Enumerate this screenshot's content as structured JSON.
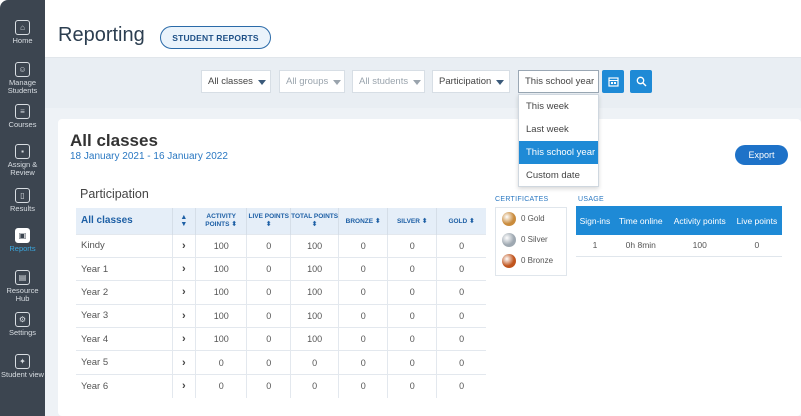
{
  "sidebar": {
    "items": [
      {
        "label": "Home",
        "icon": "home-icon",
        "glyph": "⌂"
      },
      {
        "label": "Manage Students",
        "icon": "students-icon",
        "glyph": "☺"
      },
      {
        "label": "Courses",
        "icon": "courses-icon",
        "glyph": "≡"
      },
      {
        "label": "Assign & Review",
        "icon": "assign-icon",
        "glyph": "▪"
      },
      {
        "label": "Results",
        "icon": "results-icon",
        "glyph": "▯"
      },
      {
        "label": "Reports",
        "icon": "reports-icon",
        "glyph": "▣"
      },
      {
        "label": "Resource Hub",
        "icon": "resource-icon",
        "glyph": "▤"
      },
      {
        "label": "Settings",
        "icon": "gear-icon",
        "glyph": "⚙"
      },
      {
        "label": "Student view",
        "icon": "student-view-icon",
        "glyph": "✦"
      }
    ],
    "active_index": 5
  },
  "header": {
    "title": "Reporting",
    "student_reports_label": "STUDENT REPORTS"
  },
  "filters": {
    "classes": "All classes",
    "groups": "All groups",
    "students": "All students",
    "metric": "Participation",
    "date": "This school year",
    "calendar_icon": "calendar-icon",
    "search_icon": "search-icon"
  },
  "date_menu": {
    "options": [
      "This week",
      "Last week",
      "This school year",
      "Custom date"
    ],
    "selected": "This school year"
  },
  "content": {
    "title": "All classes",
    "date_range": "18 January 2021 - 16 January 2022",
    "export_label": "Export",
    "section_title": "Participation"
  },
  "participation_table": {
    "headers": [
      "All classes",
      "",
      "ACTIVITY POINTS",
      "LIVE POINTS",
      "TOTAL POINTS",
      "BRONZE",
      "SILVER",
      "GOLD"
    ],
    "rows": [
      {
        "name": "Kindy",
        "activity": "100",
        "live": "0",
        "total": "100",
        "bronze": "0",
        "silver": "0",
        "gold": "0"
      },
      {
        "name": "Year 1",
        "activity": "100",
        "live": "0",
        "total": "100",
        "bronze": "0",
        "silver": "0",
        "gold": "0"
      },
      {
        "name": "Year 2",
        "activity": "100",
        "live": "0",
        "total": "100",
        "bronze": "0",
        "silver": "0",
        "gold": "0"
      },
      {
        "name": "Year 3",
        "activity": "100",
        "live": "0",
        "total": "100",
        "bronze": "0",
        "silver": "0",
        "gold": "0"
      },
      {
        "name": "Year 4",
        "activity": "100",
        "live": "0",
        "total": "100",
        "bronze": "0",
        "silver": "0",
        "gold": "0"
      },
      {
        "name": "Year 5",
        "activity": "0",
        "live": "0",
        "total": "0",
        "bronze": "0",
        "silver": "0",
        "gold": "0"
      },
      {
        "name": "Year 6",
        "activity": "0",
        "live": "0",
        "total": "0",
        "bronze": "0",
        "silver": "0",
        "gold": "0"
      }
    ]
  },
  "certificates": {
    "heading": "CERTIFICATES",
    "items": [
      {
        "label": "0 Gold",
        "color": "#c98b3c"
      },
      {
        "label": "0 Silver",
        "color": "#9ea8b1"
      },
      {
        "label": "0 Bronze",
        "color": "#c0551e"
      }
    ]
  },
  "usage": {
    "heading": "USAGE",
    "headers": [
      "Sign-ins",
      "Time online",
      "Activity points",
      "Live points"
    ],
    "row": [
      "1",
      "0h 8min",
      "100",
      "0"
    ]
  }
}
